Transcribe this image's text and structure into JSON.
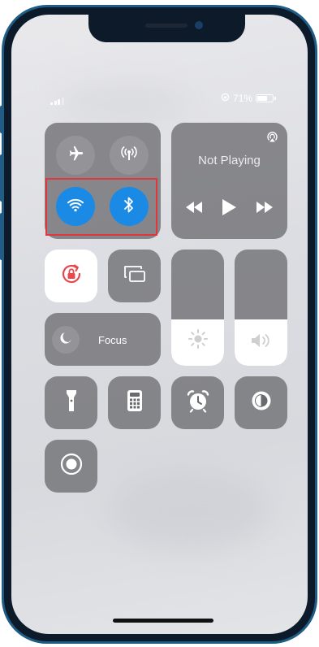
{
  "status_bar": {
    "battery_percent": "71%",
    "battery_level": 0.71
  },
  "connectivity": {
    "airplane_icon": "airplane-icon",
    "cellular_icon": "cellular-data-icon",
    "wifi_icon": "wifi-icon",
    "bluetooth_icon": "bluetooth-icon",
    "wifi_on": true,
    "bluetooth_on": true,
    "highlight_color": "#e0363c"
  },
  "media": {
    "title": "Not Playing"
  },
  "controls": {
    "focus_label": "Focus"
  },
  "sliders": {
    "brightness_level": 0.4,
    "volume_level": 0.4
  },
  "colors": {
    "accent_blue": "#1a8ae5",
    "lock_red": "#e5484d"
  }
}
